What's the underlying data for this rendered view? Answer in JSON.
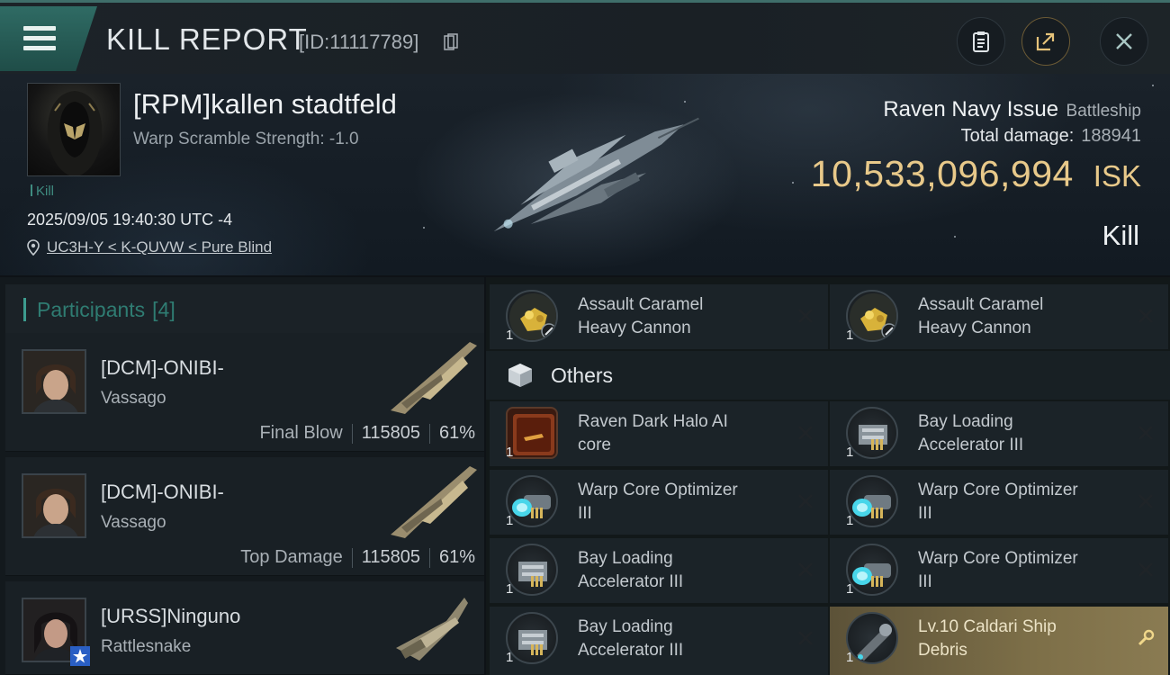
{
  "header": {
    "title": "KILL REPORT",
    "report_id": "[ID:11117789]"
  },
  "victim": {
    "name": "[RPM]kallen stadtfeld",
    "warp_scramble": "Warp Scramble Strength: -1.0",
    "kill_label": "Kill",
    "datetime": "2025/09/05 19:40:30 UTC -4",
    "location": "UC3H-Y < K-QUVW < Pure Blind",
    "ship_name": "Raven Navy Issue",
    "ship_class": "Battleship",
    "total_damage_label": "Total damage:",
    "total_damage": "188941",
    "isk_value": "10,533,096,994",
    "isk_unit": "ISK",
    "result": "Kill"
  },
  "participants": {
    "label": "Participants",
    "count": "[4]",
    "rows": [
      {
        "name": "[DCM]-ONIBI-",
        "ship": "Vassago",
        "tag": "Final Blow",
        "damage": "115805",
        "percent": "61%"
      },
      {
        "name": "[DCM]-ONIBI-",
        "ship": "Vassago",
        "tag": "Top Damage",
        "damage": "115805",
        "percent": "61%"
      },
      {
        "name": "[URSS]Ninguno",
        "ship": "Rattlesnake",
        "tag": "",
        "damage": "",
        "percent": ""
      }
    ]
  },
  "items": {
    "top_row": [
      {
        "qty": "1",
        "name_1": "Assault Caramel",
        "name_2": "Heavy Cannon"
      },
      {
        "qty": "1",
        "name_1": "Assault Caramel",
        "name_2": "Heavy Cannon"
      }
    ],
    "others_label": "Others",
    "others": [
      {
        "qty": "1",
        "name_1": "Raven Dark Halo AI",
        "name_2": "core"
      },
      {
        "qty": "1",
        "name_1": "Bay Loading",
        "name_2": "Accelerator III"
      },
      {
        "qty": "1",
        "name_1": "Warp Core Optimizer",
        "name_2": "III"
      },
      {
        "qty": "1",
        "name_1": "Warp Core Optimizer",
        "name_2": "III"
      },
      {
        "qty": "1",
        "name_1": "Bay Loading",
        "name_2": "Accelerator III"
      },
      {
        "qty": "1",
        "name_1": "Warp Core Optimizer",
        "name_2": "III"
      },
      {
        "qty": "1",
        "name_1": "Bay Loading",
        "name_2": "Accelerator III"
      },
      {
        "qty": "1",
        "name_1": "Lv.10 Caldari Ship",
        "name_2": "Debris"
      }
    ]
  },
  "colors": {
    "accent": "#3d9c8f",
    "isk": "#e8c98a",
    "highlight": "#7d6f48"
  }
}
